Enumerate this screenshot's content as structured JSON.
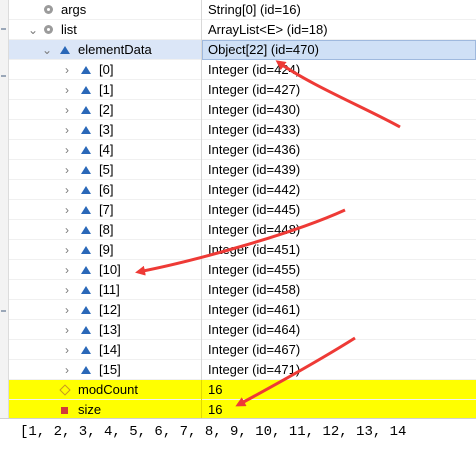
{
  "variables": {
    "rows": [
      {
        "name": "args",
        "value": "String[0]  (id=16)"
      },
      {
        "name": "list",
        "value": "ArrayList<E>  (id=18)"
      },
      {
        "name": "elementData",
        "value": "Object[22]  (id=470)"
      },
      {
        "name": "[0]",
        "value": "Integer  (id=424)"
      },
      {
        "name": "[1]",
        "value": "Integer  (id=427)"
      },
      {
        "name": "[2]",
        "value": "Integer  (id=430)"
      },
      {
        "name": "[3]",
        "value": "Integer  (id=433)"
      },
      {
        "name": "[4]",
        "value": "Integer  (id=436)"
      },
      {
        "name": "[5]",
        "value": "Integer  (id=439)"
      },
      {
        "name": "[6]",
        "value": "Integer  (id=442)"
      },
      {
        "name": "[7]",
        "value": "Integer  (id=445)"
      },
      {
        "name": "[8]",
        "value": "Integer  (id=448)"
      },
      {
        "name": "[9]",
        "value": "Integer  (id=451)"
      },
      {
        "name": "[10]",
        "value": "Integer  (id=455)"
      },
      {
        "name": "[11]",
        "value": "Integer  (id=458)"
      },
      {
        "name": "[12]",
        "value": "Integer  (id=461)"
      },
      {
        "name": "[13]",
        "value": "Integer  (id=464)"
      },
      {
        "name": "[14]",
        "value": "Integer  (id=467)"
      },
      {
        "name": "[15]",
        "value": "Integer  (id=471)"
      },
      {
        "name": "modCount",
        "value": "16"
      },
      {
        "name": "size",
        "value": "16"
      }
    ]
  },
  "console": {
    "output": "[1, 2, 3, 4, 5, 6, 7, 8, 9, 10, 11, 12, 13, 14"
  },
  "colors": {
    "highlight": "#ffff00",
    "selection": "#dbe6f7",
    "arrow": "#ee3a36",
    "field_icon": "#2a68b8"
  },
  "icons": {
    "local": "local-variable-icon",
    "field": "field-triangle-icon",
    "modcount": "field-diamond-icon",
    "size": "field-square-icon"
  }
}
